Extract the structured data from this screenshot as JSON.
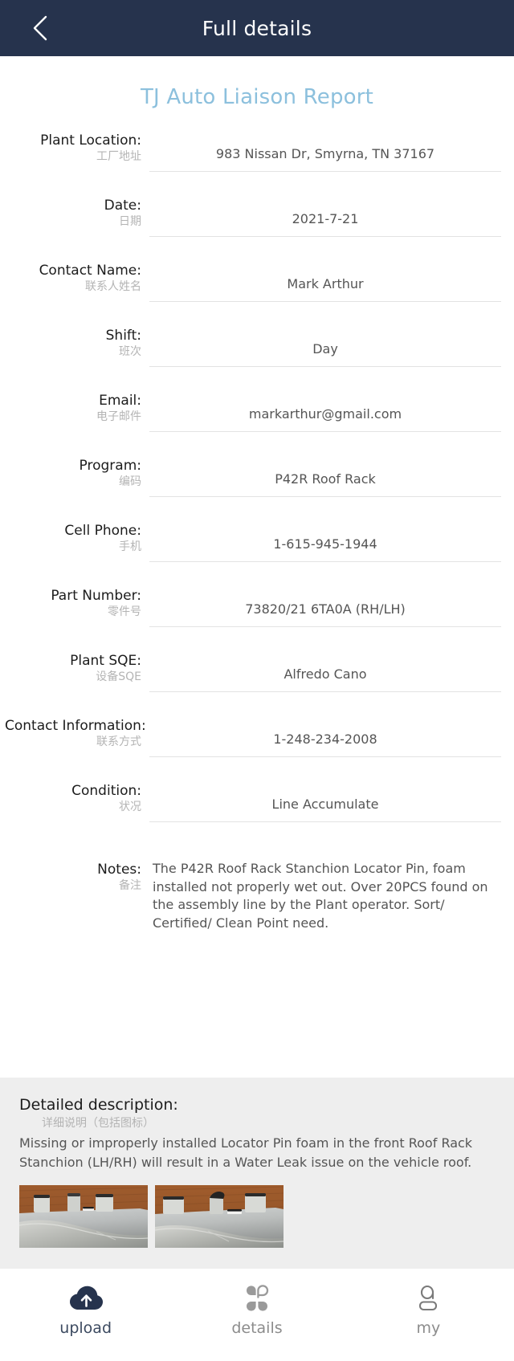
{
  "header": {
    "title": "Full details",
    "back_icon": "chevron-left-icon",
    "bg_color": "#26334d"
  },
  "report": {
    "title": "TJ Auto Liaison Report",
    "title_color": "#8cc0dd"
  },
  "fields": [
    {
      "label_en": "Plant Location:",
      "label_cn": "工厂地址",
      "value": "983 Nissan Dr, Smyrna, TN 37167"
    },
    {
      "label_en": "Date:",
      "label_cn": "日期",
      "value": "2021-7-21"
    },
    {
      "label_en": "Contact Name:",
      "label_cn": "联系人姓名",
      "value": "Mark Arthur"
    },
    {
      "label_en": "Shift:",
      "label_cn": "班次",
      "value": "Day"
    },
    {
      "label_en": "Email:",
      "label_cn": "电子邮件",
      "value": "markarthur@gmail.com"
    },
    {
      "label_en": "Program:",
      "label_cn": "编码",
      "value": "P42R Roof Rack"
    },
    {
      "label_en": "Cell Phone:",
      "label_cn": "手机",
      "value": "1-615-945-1944"
    },
    {
      "label_en": "Part Number:",
      "label_cn": "零件号",
      "value": "73820/21 6TA0A (RH/LH)"
    },
    {
      "label_en": "Plant SQE:",
      "label_cn": "设备SQE",
      "value": "Alfredo Cano"
    },
    {
      "label_en": "Contact Information:",
      "label_cn": "联系方式",
      "value": "1-248-234-2008"
    },
    {
      "label_en": "Condition:",
      "label_cn": "状况",
      "value": "Line Accumulate"
    }
  ],
  "notes": {
    "label_en": "Notes:",
    "label_cn": "备注",
    "text": "The P42R Roof Rack Stanchion Locator Pin, foam installed not properly wet out. Over 20PCS found on the assembly line by the Plant operator. Sort/ Certified/ Clean Point need."
  },
  "detailed_description": {
    "heading_en": "Detailed description:",
    "heading_cn": "详细说明（包括图标）",
    "text": "Missing or improperly installed Locator Pin foam in the front Roof Rack Stanchion (LH/RH) will result in a Water Leak issue on the vehicle roof.",
    "photos": [
      {
        "name": "roof-rack-stanchion-photo-1",
        "alt": "Gray roof rack stanchion part with locator pins on wooden table"
      },
      {
        "name": "roof-rack-stanchion-photo-2",
        "alt": "Close-up of roof rack stanchion showing locator pin foam"
      }
    ]
  },
  "tabbar": {
    "items": [
      {
        "label": "upload",
        "icon": "cloud-upload-icon",
        "active": true
      },
      {
        "label": "details",
        "icon": "clover-grid-icon",
        "active": false
      },
      {
        "label": "my",
        "icon": "person-outline-icon",
        "active": false
      }
    ]
  }
}
